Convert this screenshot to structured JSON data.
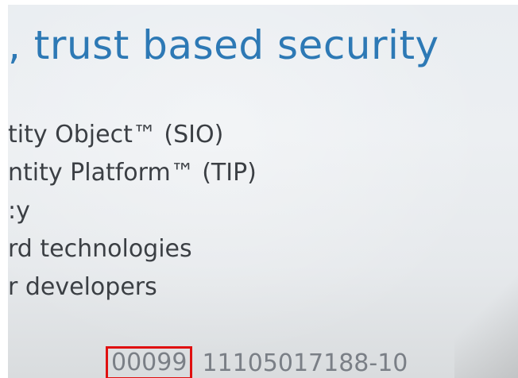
{
  "headline": ", trust based security",
  "bullets": [
    "tity Object™ (SIO)",
    "ntity Platform™ (TIP)",
    ":y",
    "rd technologies",
    "r developers"
  ],
  "serial": {
    "highlighted_code": "00099",
    "number": "11105017188-10"
  },
  "colors": {
    "headline": "#2d79b5",
    "body_text": "#3b3f44",
    "highlight_box": "#e01010"
  }
}
